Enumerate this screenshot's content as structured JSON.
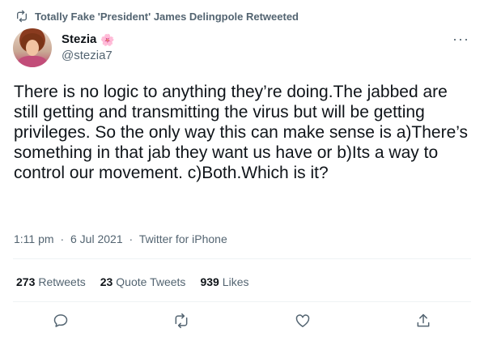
{
  "retweet_banner": {
    "text": "Totally Fake 'President' James Delingpole Retweeted",
    "icon": "retweet-icon"
  },
  "author": {
    "display_name": "Stezia",
    "emoji": "🌸",
    "handle": "@stezia7"
  },
  "tweet": {
    "text": "There is no logic to anything they’re doing.The jabbed are still getting and transmitting the virus but will be getting privileges. So the only way this can make sense is a)There’s something in that jab they want us have or b)Its a way to control our movement. c)Both.Which is it?",
    "time": "1:11 pm",
    "date": "6 Jul 2021",
    "source": "Twitter for iPhone"
  },
  "stats": {
    "retweets_count": "273",
    "retweets_label": "Retweets",
    "quotes_count": "23",
    "quotes_label": "Quote Tweets",
    "likes_count": "939",
    "likes_label": "Likes"
  },
  "actions": [
    "reply-icon",
    "retweet-icon",
    "like-icon",
    "share-icon"
  ],
  "colors": {
    "secondary_text": "#536471",
    "primary_text": "#0f1419",
    "divider": "#eff3f4"
  }
}
